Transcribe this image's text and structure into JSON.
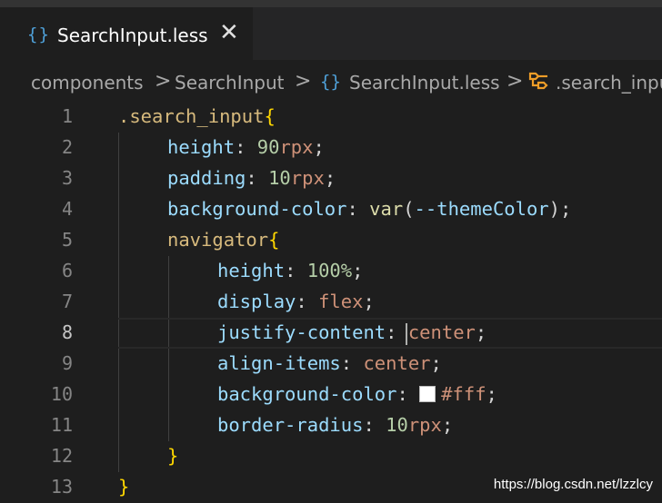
{
  "tab": {
    "icon": "{}",
    "icon_name": "braces-icon",
    "title": "SearchInput.less",
    "close": "✕"
  },
  "breadcrumb": {
    "items": [
      "components",
      "SearchInput",
      "SearchInput.less",
      ".search_inpu"
    ],
    "separator": ">"
  },
  "editor": {
    "active_line": 8,
    "lines": [
      "1",
      "2",
      "3",
      "4",
      "5",
      "6",
      "7",
      "8",
      "9",
      "10",
      "11",
      "12",
      "13"
    ],
    "tokens": {
      "l1_sel": ".search_input",
      "l1_brace": "{",
      "l2_prop": "height",
      "l2_colon": ": ",
      "l2_num": "90",
      "l2_unit": "rpx",
      "l2_semi": ";",
      "l3_prop": "padding",
      "l3_colon": ": ",
      "l3_num": "10",
      "l3_unit": "rpx",
      "l3_semi": ";",
      "l4_prop": "background-color",
      "l4_colon": ": ",
      "l4_fn": "var",
      "l4_open": "(",
      "l4_var": "--themeColor",
      "l4_close": ")",
      "l4_semi": ";",
      "l5_sel": "navigator",
      "l5_brace": "{",
      "l6_prop": "height",
      "l6_colon": ": ",
      "l6_num": "100%",
      "l6_semi": ";",
      "l7_prop": "display",
      "l7_colon": ": ",
      "l7_val": "flex",
      "l7_semi": ";",
      "l8_prop": "justify-content",
      "l8_colon": ": ",
      "l8_val": "center",
      "l8_semi": ";",
      "l9_prop": "align-items",
      "l9_colon": ": ",
      "l9_val": "center",
      "l9_semi": ";",
      "l10_prop": "background-color",
      "l10_colon": ": ",
      "l10_val": "#fff",
      "l10_semi": ";",
      "l11_prop": "border-radius",
      "l11_colon": ": ",
      "l11_num": "10",
      "l11_unit": "rpx",
      "l11_semi": ";",
      "l12_brace": "}",
      "l13_brace": "}"
    }
  },
  "watermark": "https://blog.csdn.net/lzzlcy",
  "colors": {
    "background": "#1e1e1e",
    "selector": "#d7ba7d",
    "property": "#9cdcfe",
    "number": "#b5cea8",
    "value": "#ce9178",
    "function": "#dcdcaa",
    "bracket": "#ffd700"
  }
}
